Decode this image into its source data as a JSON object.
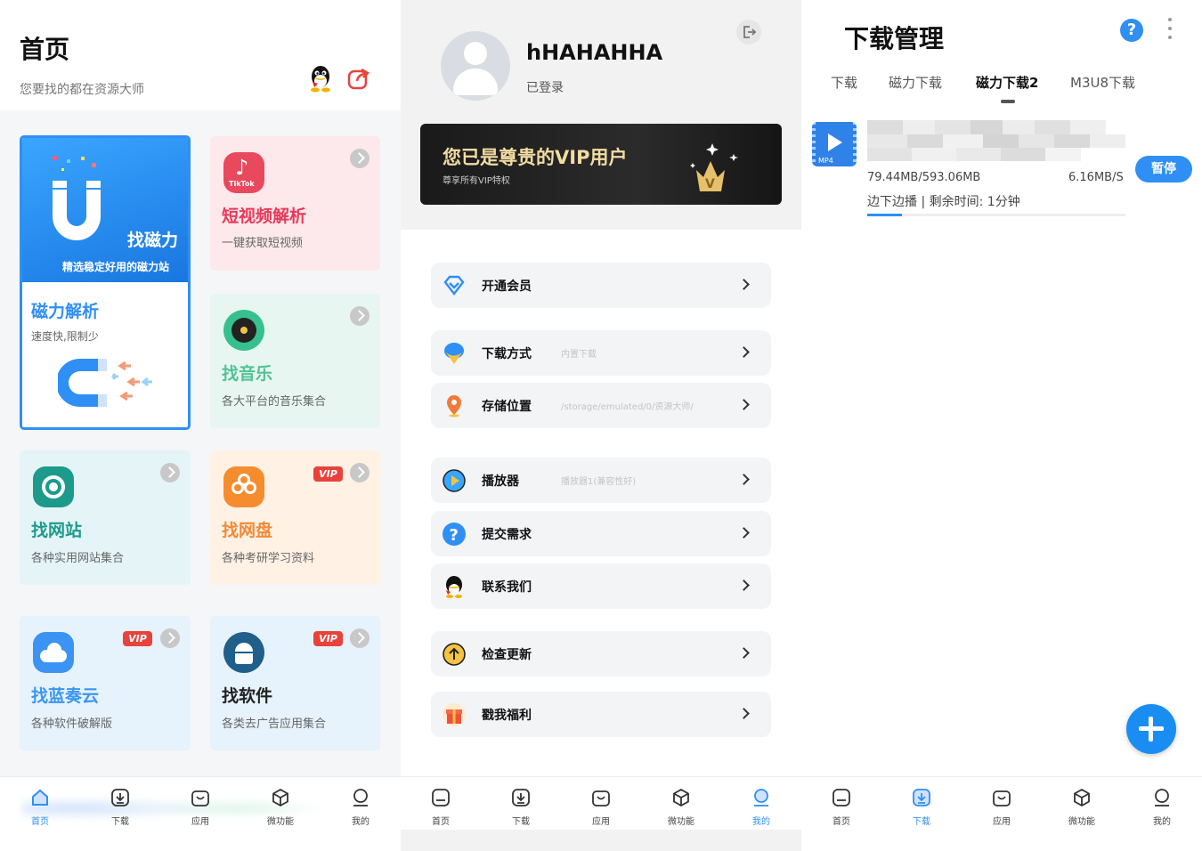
{
  "colors": {
    "accent": "#2f8ff4",
    "vip_red": "#e8423b",
    "vip_gold": "#f3dca2"
  },
  "home": {
    "title": "首页",
    "subtitle": "您要找的都在资源大师",
    "cards": {
      "magnet": {
        "title": "找磁力",
        "desc": "精选稳定好用的磁力站"
      },
      "magnet_parse": {
        "title": "磁力解析",
        "desc": "速度快,限制少"
      },
      "video": {
        "title": "短视频解析",
        "desc": "一键获取短视频",
        "icon_text": "TikTok"
      },
      "music": {
        "title": "找音乐",
        "desc": "各大平台的音乐集合"
      },
      "web": {
        "title": "找网站",
        "desc": "各种实用网站集合"
      },
      "pan": {
        "title": "找网盘",
        "desc": "各种考研学习资料",
        "badge": "VIP"
      },
      "lanzou": {
        "title": "找蓝奏云",
        "desc": "各种软件破解版",
        "badge": "VIP"
      },
      "soft": {
        "title": "找软件",
        "desc": "各类去广告应用集合",
        "badge": "VIP"
      }
    }
  },
  "nav": {
    "home": "首页",
    "download": "下载",
    "apps": "应用",
    "micro": "微功能",
    "mine": "我的"
  },
  "profile": {
    "username": "hHAHAHHA",
    "status": "已登录",
    "vip_title": "您已是尊贵的VIP用户",
    "vip_sub": "尊享所有VIP特权",
    "vip_crown_letter": "V",
    "menu": [
      {
        "label": "开通会员",
        "value": ""
      },
      {
        "label": "下载方式",
        "value": "内置下载"
      },
      {
        "label": "存储位置",
        "value": "/storage/emulated/0/资源大师/"
      },
      {
        "label": "播放器",
        "value": "播放器1(兼容性好)"
      },
      {
        "label": "提交需求",
        "value": ""
      },
      {
        "label": "联系我们",
        "value": ""
      },
      {
        "label": "检查更新",
        "value": ""
      },
      {
        "label": "戳我福利",
        "value": ""
      }
    ]
  },
  "downloads": {
    "title": "下载管理",
    "help": "?",
    "tabs": [
      "下载",
      "磁力下载",
      "磁力下载2",
      "M3U8下载"
    ],
    "item": {
      "format": "MP4",
      "size": "79.44MB/593.06MB",
      "speed": "6.16MB/S",
      "info": "边下边播 | 剩余时间: 1分钟",
      "progress": 0.134,
      "action": "暂停"
    }
  }
}
